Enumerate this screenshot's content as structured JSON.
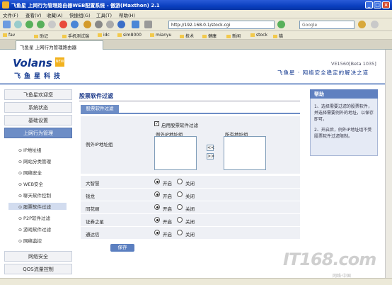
{
  "window": {
    "title": "飞鱼星 上网行为管理路由器WEB配置系统 - 傲游(Maxthon) 2.1"
  },
  "menubar": [
    "文件(F)",
    "查看(V)",
    "收藏(A)",
    "快捷组(G)",
    "工具(T)",
    "帮助(H)"
  ],
  "toolbar": {
    "address": "http://192.168.0.1/stock.cgi",
    "search_placeholder": "Google"
  },
  "bookmarks": [
    "fav",
    "助记",
    "手机测试端",
    "idc",
    "sim8000",
    "mianyu",
    "技术",
    "健康",
    "新闻",
    "stock",
    "猫"
  ],
  "tab": {
    "label": "飞鱼星 上网行为管理路由器"
  },
  "header": {
    "logo": "Volans",
    "logo_badge": "NEW",
    "logo_cn": "飞鱼星科技",
    "version": "VE1560[Beta 1035]",
    "slogan": "飞鱼星 · 网络安全稳定的解决之道"
  },
  "sidebar": {
    "items_top": [
      "飞鱼星欢迎您",
      "系统状态",
      "基础设置",
      "上网行为管理"
    ],
    "subitems": [
      "IP地址组",
      "网站分类管理",
      "网络安全",
      "WEB安全",
      "聊天软件控制",
      "股票软件过滤",
      "P2P软件过滤",
      "游戏软件过滤",
      "网络监控"
    ],
    "active_sub": 5,
    "items_bottom": [
      "网络安全",
      "QOS流量控制"
    ]
  },
  "main": {
    "title": "股票软件过滤",
    "subtab": "股票软件过滤",
    "enable_label": "启用股票软件过滤",
    "ip_group_label": "例外IP地址组",
    "list_left_title": "例外IP地址组",
    "list_right_title": "所有地址组",
    "move_right": ">>",
    "move_left": "<<",
    "apps": [
      {
        "name": "大智慧",
        "on": "开启",
        "off": "关闭"
      },
      {
        "name": "钱龙",
        "on": "开启",
        "off": "关闭"
      },
      {
        "name": "同花顺",
        "on": "开启",
        "off": "关闭"
      },
      {
        "name": "证券之星",
        "on": "开启",
        "off": "关闭"
      },
      {
        "name": "通达信",
        "on": "开启",
        "off": "关闭"
      }
    ],
    "save_label": "保存"
  },
  "help": {
    "title": "帮助",
    "text1": "1、选择需要过滤的股票软件，并选择需要例外的地址，以保存即可。",
    "text2": "2、开启后，例外IP地址组不受股票软件过滤限制。"
  },
  "watermark": "IT168.com",
  "watermark_sub": "网络·中国"
}
